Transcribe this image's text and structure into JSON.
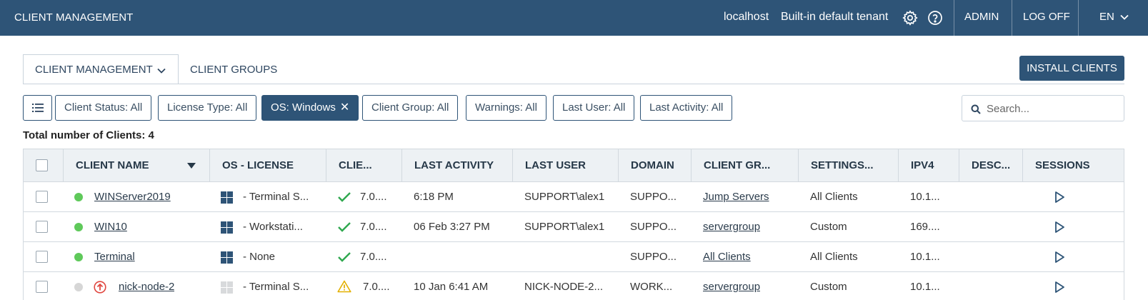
{
  "topbar": {
    "app_title": "CLIENT MANAGEMENT",
    "host": "localhost",
    "tenant": "Built-in default tenant",
    "admin": "ADMIN",
    "logoff": "LOG OFF",
    "lang": "EN"
  },
  "tabs": {
    "client_management": "CLIENT MANAGEMENT",
    "client_groups": "CLIENT GROUPS"
  },
  "install_button": "INSTALL CLIENTS",
  "filters": {
    "client_status": "Client Status: All",
    "license_type": "License Type: All",
    "os": "OS: Windows",
    "client_group": "Client Group: All",
    "warnings": "Warnings: All",
    "last_user": "Last User: All",
    "last_activity": "Last Activity: All"
  },
  "search": {
    "placeholder": "Search..."
  },
  "total": "Total number of Clients: 4",
  "table": {
    "headers": {
      "client_name": "CLIENT NAME",
      "os_license": "OS - LICENSE",
      "client_version": "CLIE...",
      "last_activity": "LAST ACTIVITY",
      "last_user": "LAST USER",
      "domain": "DOMAIN",
      "client_group": "CLIENT GR...",
      "settings": "SETTINGS...",
      "ipv4": "IPV4",
      "description": "DESC...",
      "sessions": "SESSIONS"
    },
    "rows": [
      {
        "status": "online",
        "name": "WINServer2019",
        "os_license": "- Terminal S...",
        "version": "7.0....",
        "last_activity": "6:18 PM",
        "last_user": "SUPPORT\\alex1",
        "domain": "SUPPO...",
        "group": "Jump Servers",
        "settings": "All Clients",
        "ipv4": "10.1..."
      },
      {
        "status": "online",
        "name": "WIN10",
        "os_license": "- Workstati...",
        "version": "7.0....",
        "last_activity": "06 Feb 3:27 PM",
        "last_user": "SUPPORT\\alex1",
        "domain": "SUPPO...",
        "group": "servergroup",
        "settings": "Custom",
        "ipv4": "169...."
      },
      {
        "status": "online",
        "name": "Terminal",
        "os_license": "- None",
        "version": "7.0....",
        "last_activity": "",
        "last_user": "",
        "domain": "SUPPO...",
        "group": "All Clients",
        "settings": "All Clients",
        "ipv4": "10.1..."
      },
      {
        "status": "offline",
        "name": "nick-node-2",
        "os_license": "- Terminal S...",
        "version": "7.0....",
        "last_activity": "10 Jan 6:41 AM",
        "last_user": "NICK-NODE-2...",
        "domain": "WORK...",
        "group": "servergroup",
        "settings": "Custom",
        "ipv4": "10.1..."
      }
    ]
  },
  "colors": {
    "brand": "#2e5477",
    "online": "#5fc95a",
    "offline": "#d6d6d6",
    "ok_check": "#2fa84f",
    "warning": "#e3b000",
    "update_alert": "#e0463f"
  },
  "icons": {
    "settings": "gear-icon",
    "help": "help-icon",
    "list_view": "list-icon",
    "search": "search-icon",
    "os": "windows-icon",
    "version_ok": "check-icon",
    "version_warning": "warning-icon",
    "update": "update-alert-icon",
    "session": "play-icon"
  }
}
